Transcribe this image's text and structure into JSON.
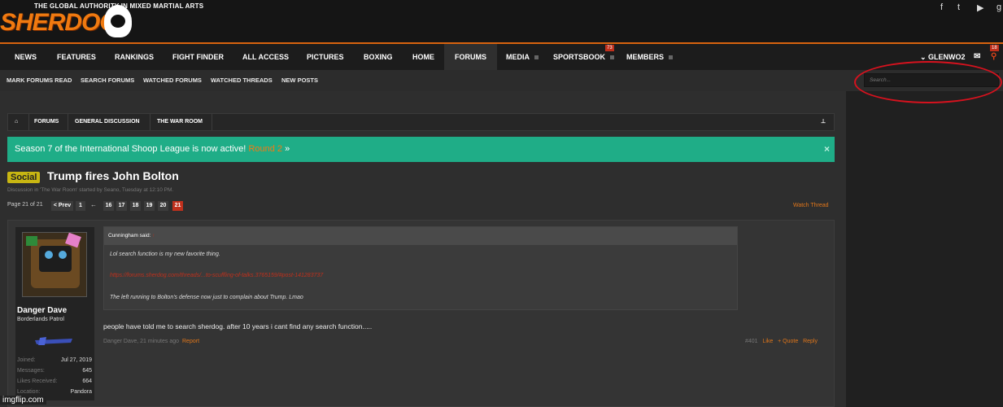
{
  "header": {
    "tagline": "THE GLOBAL AUTHORITY IN MIXED MARTIAL ARTS",
    "logo_text": "SHERDOG",
    "social_icons": [
      "facebook-icon",
      "twitter-icon",
      "youtube-icon",
      "google-plus-icon"
    ]
  },
  "nav": {
    "items": [
      "NEWS",
      "FEATURES",
      "RANKINGS",
      "FIGHT FINDER",
      "ALL ACCESS",
      "PICTURES",
      "BOXING",
      "HOME",
      "FORUMS",
      "MEDIA",
      "SPORTSBOOK",
      "MEMBERS"
    ],
    "active": "FORUMS",
    "sportsbook_badge": "73",
    "user": "GLENWO2",
    "alerts_badge": "18"
  },
  "subnav": {
    "items": [
      "MARK FORUMS READ",
      "SEARCH FORUMS",
      "WATCHED FORUMS",
      "WATCHED THREADS",
      "NEW POSTS"
    ],
    "search_placeholder": "Search..."
  },
  "breadcrumb": [
    "FORUMS",
    "GENERAL DISCUSSION",
    "THE WAR ROOM"
  ],
  "notice": {
    "text": "Season 7 of the International Shoop League is now active! ",
    "link": "Round 2",
    "arrow": " »",
    "close": "×"
  },
  "thread": {
    "prefix": "Social",
    "title": "Trump fires John Bolton",
    "meta": "Discussion in 'The War Room' started by Seano, Tuesday at 12:10 PM.",
    "watch": "Watch Thread"
  },
  "pagination": {
    "label": "Page 21 of 21",
    "prev": "< Prev",
    "first": "1",
    "ellipsis": "←",
    "pages": [
      "16",
      "17",
      "18",
      "19",
      "20",
      "21"
    ],
    "current": "21"
  },
  "post": {
    "user": {
      "name": "Danger Dave",
      "title": "Borderlands Patrol",
      "stats": [
        {
          "label": "Joined:",
          "value": "Jul 27, 2019"
        },
        {
          "label": "Messages:",
          "value": "645"
        },
        {
          "label": "Likes Received:",
          "value": "664"
        },
        {
          "label": "Location:",
          "value": "Pandora"
        }
      ]
    },
    "quote": {
      "author": "Cunningham said:",
      "line1": "Lol search function is my new favorite thing.",
      "link": "https://forums.sherdog.com/threads/...to-scuffling-of-talks.3765159/#post-141283737",
      "line2": "The left running to Bolton's defense now just to complain about Trump. Lmao"
    },
    "message": "people have told me to search sherdog. after 10 years i cant find any search function.....",
    "meta": "Danger Dave, 21 minutes ago",
    "report": "Report",
    "number": "#401",
    "like": "Like",
    "quote_btn": "+ Quote",
    "reply": "Reply"
  },
  "watermark": "imgflip.com"
}
